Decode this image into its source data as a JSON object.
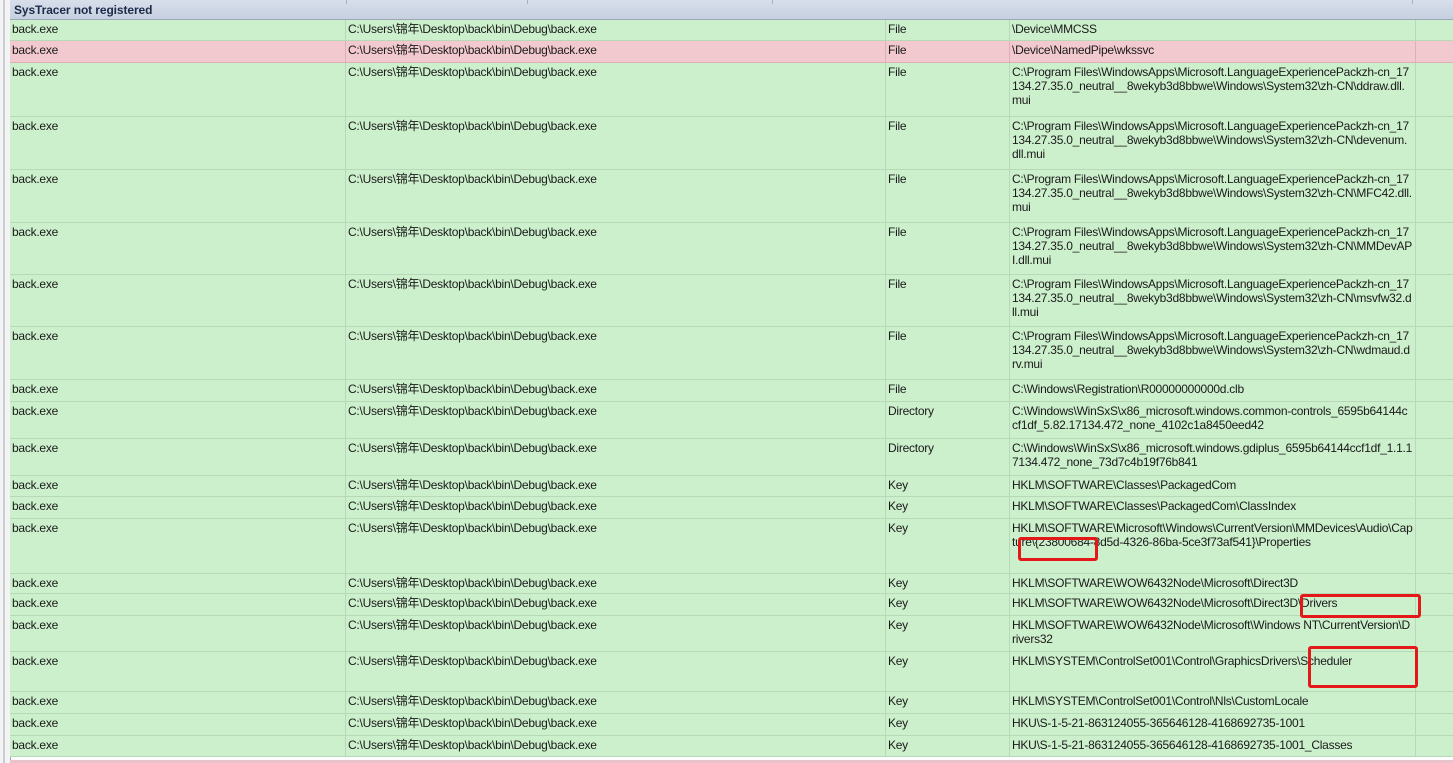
{
  "header": {
    "title": "SysTracer not registered"
  },
  "rows": [
    {
      "process": "back.exe",
      "path": "C:\\Users\\锦年\\Desktop\\back\\bin\\Debug\\back.exe",
      "type": "File",
      "resource": "\\Device\\MMCSS",
      "alert": false
    },
    {
      "process": "back.exe",
      "path": "C:\\Users\\锦年\\Desktop\\back\\bin\\Debug\\back.exe",
      "type": "File",
      "resource": "\\Device\\NamedPipe\\wkssvc",
      "alert": true
    },
    {
      "process": "back.exe",
      "path": "C:\\Users\\锦年\\Desktop\\back\\bin\\Debug\\back.exe",
      "type": "File",
      "resource": "C:\\Program Files\\WindowsApps\\Microsoft.LanguageExperiencePackzh-cn_17134.27.35.0_neutral__8wekyb3d8bbwe\\Windows\\System32\\zh-CN\\ddraw.dll.mui",
      "alert": false
    },
    {
      "process": "back.exe",
      "path": "C:\\Users\\锦年\\Desktop\\back\\bin\\Debug\\back.exe",
      "type": "File",
      "resource": "C:\\Program Files\\WindowsApps\\Microsoft.LanguageExperiencePackzh-cn_17134.27.35.0_neutral__8wekyb3d8bbwe\\Windows\\System32\\zh-CN\\devenum.dll.mui",
      "alert": false
    },
    {
      "process": "back.exe",
      "path": "C:\\Users\\锦年\\Desktop\\back\\bin\\Debug\\back.exe",
      "type": "File",
      "resource": "C:\\Program Files\\WindowsApps\\Microsoft.LanguageExperiencePackzh-cn_17134.27.35.0_neutral__8wekyb3d8bbwe\\Windows\\System32\\zh-CN\\MFC42.dll.mui",
      "alert": false
    },
    {
      "process": "back.exe",
      "path": "C:\\Users\\锦年\\Desktop\\back\\bin\\Debug\\back.exe",
      "type": "File",
      "resource": "C:\\Program Files\\WindowsApps\\Microsoft.LanguageExperiencePackzh-cn_17134.27.35.0_neutral__8wekyb3d8bbwe\\Windows\\System32\\zh-CN\\MMDevAPI.dll.mui",
      "alert": false
    },
    {
      "process": "back.exe",
      "path": "C:\\Users\\锦年\\Desktop\\back\\bin\\Debug\\back.exe",
      "type": "File",
      "resource": "C:\\Program Files\\WindowsApps\\Microsoft.LanguageExperiencePackzh-cn_17134.27.35.0_neutral__8wekyb3d8bbwe\\Windows\\System32\\zh-CN\\msvfw32.dll.mui",
      "alert": false
    },
    {
      "process": "back.exe",
      "path": "C:\\Users\\锦年\\Desktop\\back\\bin\\Debug\\back.exe",
      "type": "File",
      "resource": "C:\\Program Files\\WindowsApps\\Microsoft.LanguageExperiencePackzh-cn_17134.27.35.0_neutral__8wekyb3d8bbwe\\Windows\\System32\\zh-CN\\wdmaud.drv.mui",
      "alert": false
    },
    {
      "process": "back.exe",
      "path": "C:\\Users\\锦年\\Desktop\\back\\bin\\Debug\\back.exe",
      "type": "File",
      "resource": "C:\\Windows\\Registration\\R00000000000d.clb",
      "alert": false
    },
    {
      "process": "back.exe",
      "path": "C:\\Users\\锦年\\Desktop\\back\\bin\\Debug\\back.exe",
      "type": "Directory",
      "resource": "C:\\Windows\\WinSxS\\x86_microsoft.windows.common-controls_6595b64144ccf1df_5.82.17134.472_none_4102c1a8450eed42",
      "alert": false
    },
    {
      "process": "back.exe",
      "path": "C:\\Users\\锦年\\Desktop\\back\\bin\\Debug\\back.exe",
      "type": "Directory",
      "resource": "C:\\Windows\\WinSxS\\x86_microsoft.windows.gdiplus_6595b64144ccf1df_1.1.17134.472_none_73d7c4b19f76b841",
      "alert": false
    },
    {
      "process": "back.exe",
      "path": "C:\\Users\\锦年\\Desktop\\back\\bin\\Debug\\back.exe",
      "type": "Key",
      "resource": "HKLM\\SOFTWARE\\Classes\\PackagedCom",
      "alert": false
    },
    {
      "process": "back.exe",
      "path": "C:\\Users\\锦年\\Desktop\\back\\bin\\Debug\\back.exe",
      "type": "Key",
      "resource": "HKLM\\SOFTWARE\\Classes\\PackagedCom\\ClassIndex",
      "alert": false
    },
    {
      "process": "back.exe",
      "path": "C:\\Users\\锦年\\Desktop\\back\\bin\\Debug\\back.exe",
      "type": "Key",
      "resource": "HKLM\\SOFTWARE\\Microsoft\\Windows\\CurrentVersion\\MMDevices\\Audio\\Capture\\{23800684-8d5d-4326-86ba-5ce3f73af541}\\Properties",
      "alert": false
    },
    {
      "process": "back.exe",
      "path": "C:\\Users\\锦年\\Desktop\\back\\bin\\Debug\\back.exe",
      "type": "Key",
      "resource": "HKLM\\SOFTWARE\\WOW6432Node\\Microsoft\\Direct3D",
      "alert": false
    },
    {
      "process": "back.exe",
      "path": "C:\\Users\\锦年\\Desktop\\back\\bin\\Debug\\back.exe",
      "type": "Key",
      "resource": "HKLM\\SOFTWARE\\WOW6432Node\\Microsoft\\Direct3D\\Drivers",
      "alert": false
    },
    {
      "process": "back.exe",
      "path": "C:\\Users\\锦年\\Desktop\\back\\bin\\Debug\\back.exe",
      "type": "Key",
      "resource": "HKLM\\SOFTWARE\\WOW6432Node\\Microsoft\\Windows NT\\CurrentVersion\\Drivers32",
      "alert": false
    },
    {
      "process": "back.exe",
      "path": "C:\\Users\\锦年\\Desktop\\back\\bin\\Debug\\back.exe",
      "type": "Key",
      "resource": "HKLM\\SYSTEM\\ControlSet001\\Control\\GraphicsDrivers\\Scheduler",
      "alert": false
    },
    {
      "process": "back.exe",
      "path": "C:\\Users\\锦年\\Desktop\\back\\bin\\Debug\\back.exe",
      "type": "Key",
      "resource": "HKLM\\SYSTEM\\ControlSet001\\Control\\Nls\\CustomLocale",
      "alert": false
    },
    {
      "process": "back.exe",
      "path": "C:\\Users\\锦年\\Desktop\\back\\bin\\Debug\\back.exe",
      "type": "Key",
      "resource": "HKU\\S-1-5-21-863124055-365646128-4168692735-1001",
      "alert": false
    },
    {
      "process": "back.exe",
      "path": "C:\\Users\\锦年\\Desktop\\back\\bin\\Debug\\back.exe",
      "type": "Key",
      "resource": "HKU\\S-1-5-21-863124055-365646128-4168692735-1001_Classes",
      "alert": false
    }
  ],
  "colors": {
    "row_ok": "#ccefcc",
    "row_alert": "#f2c9cf",
    "highlight": "#e41818",
    "header": "#c6d0df"
  }
}
